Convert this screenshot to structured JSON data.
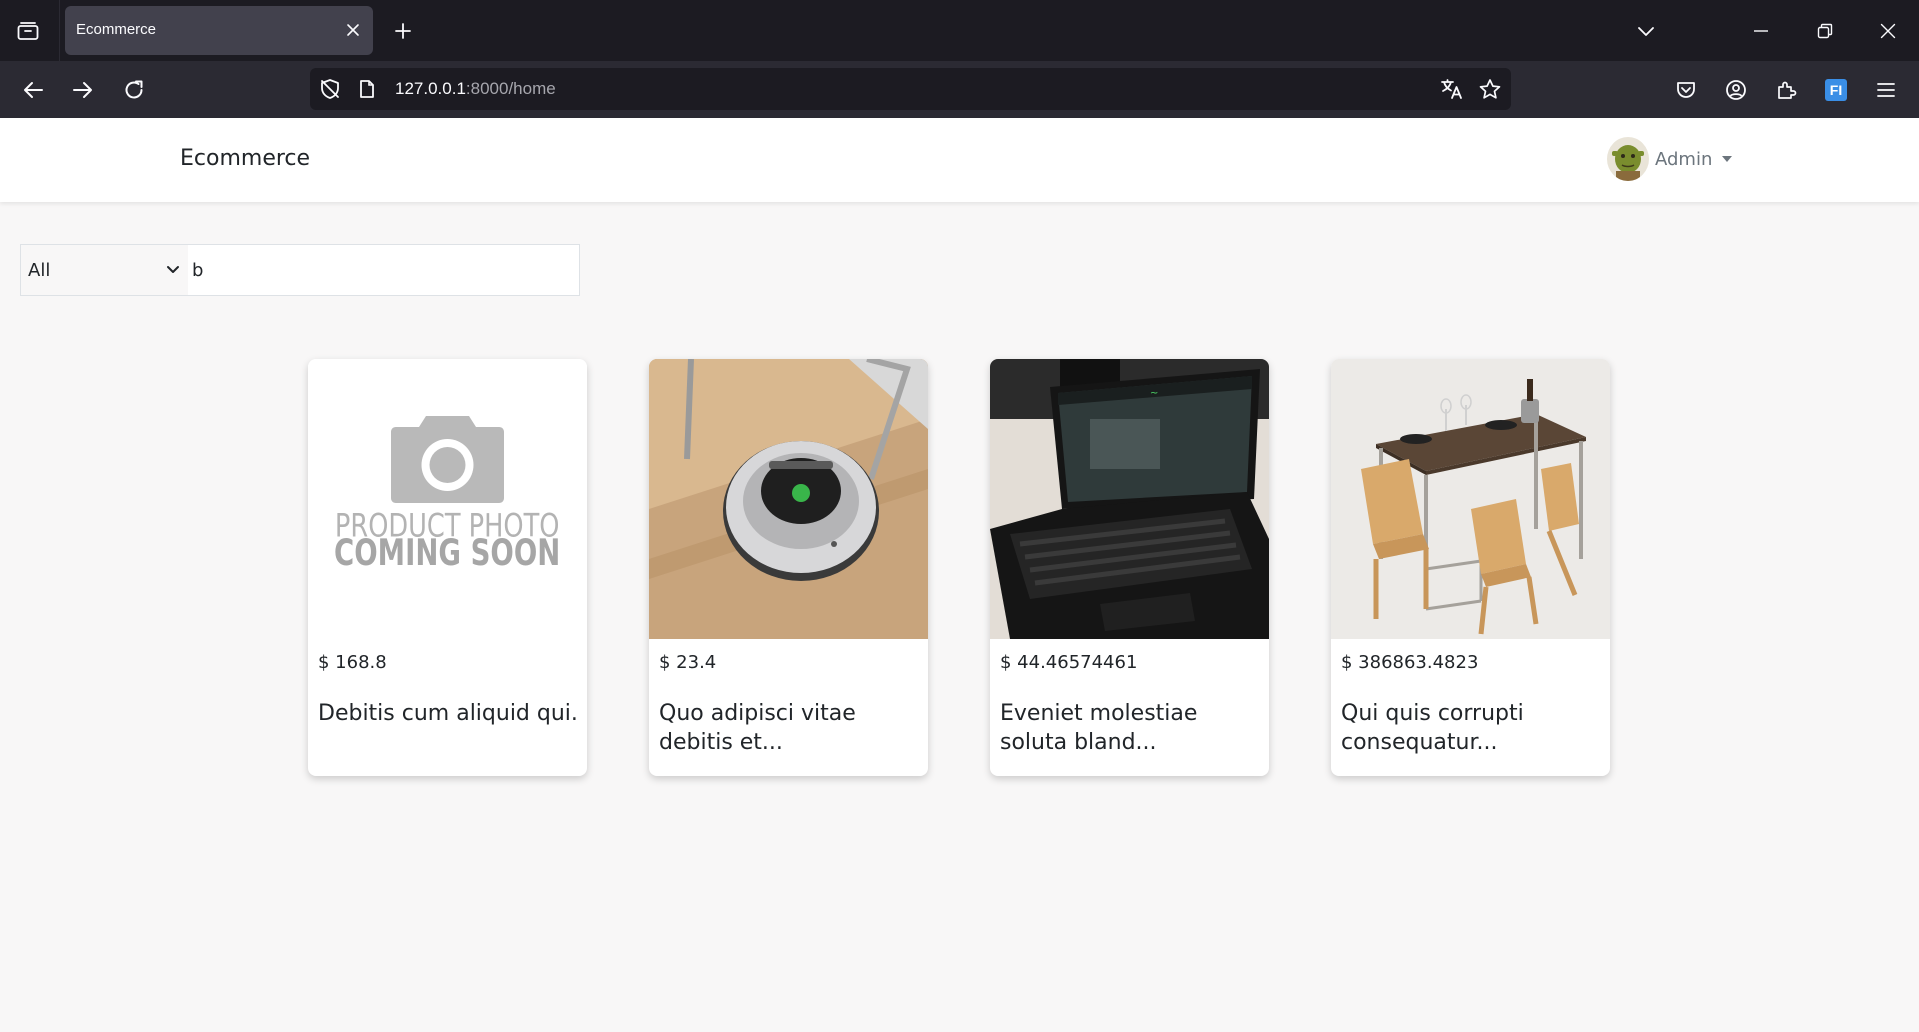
{
  "browser": {
    "tab_title": "Ecommerce",
    "url_host": "127.0.0.1",
    "url_path": ":8000/home"
  },
  "header": {
    "brand": "Ecommerce",
    "user_name": "Admin"
  },
  "search": {
    "category_selected": "All",
    "query": "b"
  },
  "products": [
    {
      "price": "$ 168.8",
      "name": "Debitis cum aliquid qui.",
      "image": "placeholder-coming-soon",
      "placeholder_line1": "PRODUCT PHOTO",
      "placeholder_line2": "COMING SOON"
    },
    {
      "price": "$ 23.4",
      "name": "Quo adipisci vitae debitis et...",
      "image": "robot-vacuum"
    },
    {
      "price": "$ 44.46574461",
      "name": "Eveniet molestiae soluta bland...",
      "image": "laptop"
    },
    {
      "price": "$ 386863.4823",
      "name": "Qui quis corrupti consequatur...",
      "image": "dining-table"
    }
  ],
  "colors": {
    "page_bg": "#f8f7f7",
    "tabbar_bg": "#1c1b22",
    "toolbar_bg": "#2b2a33",
    "accent": "#3a8ee6"
  }
}
